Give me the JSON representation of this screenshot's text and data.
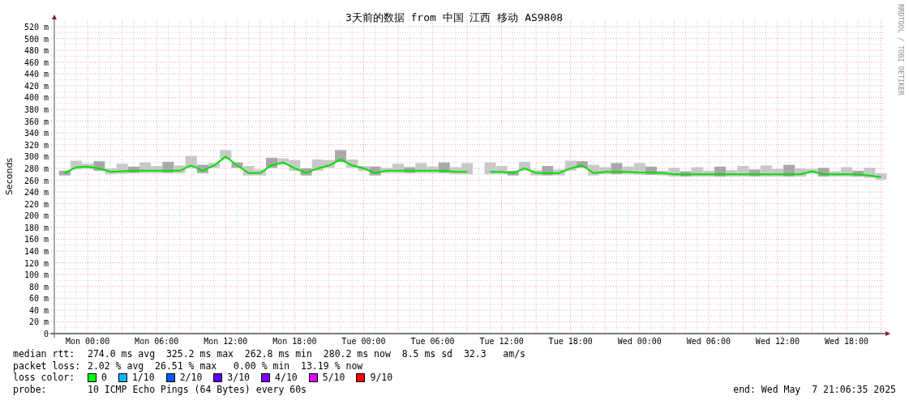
{
  "chart": {
    "watermark": "RRDTOOL / TOBI OETIKER",
    "chart_data": {
      "type": "line",
      "title": "3天前的数据 from 中国 江西 移动 AS9808",
      "ylabel": "Seconds",
      "ylim": [
        0,
        520
      ],
      "grid": true,
      "categories": [
        null,
        null,
        "Mon 00:00",
        null,
        null,
        null,
        null,
        null,
        "Mon 06:00",
        null,
        null,
        null,
        null,
        null,
        "Mon 12:00",
        null,
        null,
        null,
        null,
        null,
        "Mon 18:00",
        null,
        null,
        null,
        null,
        null,
        "Tue 00:00",
        null,
        null,
        null,
        null,
        null,
        "Tue 06:00",
        null,
        null,
        null,
        null,
        null,
        "Tue 12:00",
        null,
        null,
        null,
        null,
        null,
        "Tue 18:00",
        null,
        null,
        null,
        null,
        null,
        "Wed 00:00",
        null,
        null,
        null,
        null,
        null,
        "Wed 06:00",
        null,
        null,
        null,
        null,
        null,
        "Wed 12:00",
        null,
        null,
        null,
        null,
        null,
        "Wed 18:00",
        null,
        null,
        null
      ],
      "yticks": [
        {
          "value": 0,
          "label": "0"
        },
        {
          "value": 20,
          "label": "20 m"
        },
        {
          "value": 40,
          "label": "40 m"
        },
        {
          "value": 60,
          "label": "60 m"
        },
        {
          "value": 80,
          "label": "80 m"
        },
        {
          "value": 100,
          "label": "100 m"
        },
        {
          "value": 120,
          "label": "120 m"
        },
        {
          "value": 140,
          "label": "140 m"
        },
        {
          "value": 160,
          "label": "160 m"
        },
        {
          "value": 180,
          "label": "180 m"
        },
        {
          "value": 200,
          "label": "200 m"
        },
        {
          "value": 220,
          "label": "220 m"
        },
        {
          "value": 240,
          "label": "240 m"
        },
        {
          "value": 260,
          "label": "260 m"
        },
        {
          "value": 280,
          "label": "280 m"
        },
        {
          "value": 300,
          "label": "300 m"
        },
        {
          "value": 320,
          "label": "320 m"
        },
        {
          "value": 340,
          "label": "340 m"
        },
        {
          "value": 360,
          "label": "360 m"
        },
        {
          "value": 380,
          "label": "380 m"
        },
        {
          "value": 400,
          "label": "400 m"
        },
        {
          "value": 420,
          "label": "420 m"
        },
        {
          "value": 440,
          "label": "440 m"
        },
        {
          "value": 460,
          "label": "460 m"
        },
        {
          "value": 480,
          "label": "480 m"
        },
        {
          "value": 500,
          "label": "500 m"
        },
        {
          "value": 520,
          "label": "520 m"
        }
      ],
      "series": [
        {
          "color": "#00e000",
          "values": [
            272,
            282,
            283,
            280,
            274,
            275,
            276,
            276,
            276,
            276,
            276,
            285,
            276,
            285,
            300,
            285,
            272,
            272,
            285,
            290,
            280,
            272,
            280,
            285,
            295,
            285,
            280,
            272,
            276,
            276,
            276,
            276,
            276,
            276,
            274,
            274,
            null,
            274,
            274,
            272,
            280,
            272,
            272,
            272,
            280,
            285,
            272,
            274,
            274,
            274,
            273,
            273,
            272,
            270,
            270,
            270,
            270,
            270,
            270,
            270,
            270,
            270,
            270,
            270,
            270,
            275,
            270,
            270,
            270,
            270,
            268,
            265
          ]
        }
      ]
    }
  },
  "stats": [
    {
      "label": "median rtt:",
      "value": "274.0 ms avg  325.2 ms max  262.8 ms min  280.2 ms now  8.5 ms sd  32.3   am/s"
    },
    {
      "label": "packet loss:",
      "value": "2.02 % avg  26.51 % max   0.00 % min  13.19 % now"
    }
  ],
  "loss_legend": {
    "label": "loss color:",
    "items": [
      {
        "label": "0",
        "color": "#00ff00"
      },
      {
        "label": "1/10",
        "color": "#00b8ff"
      },
      {
        "label": "2/10",
        "color": "#0059ff"
      },
      {
        "label": "3/10",
        "color": "#5e00ff"
      },
      {
        "label": "4/10",
        "color": "#7e00ff"
      },
      {
        "label": "5/10",
        "color": "#dd00ff"
      },
      {
        "label": "9/10",
        "color": "#ff0000"
      }
    ]
  },
  "probe": {
    "label": "probe:",
    "value": "10 ICMP Echo Pings (64 Bytes) every 60s"
  },
  "end": "end: Wed May  7 21:06:35 2025"
}
